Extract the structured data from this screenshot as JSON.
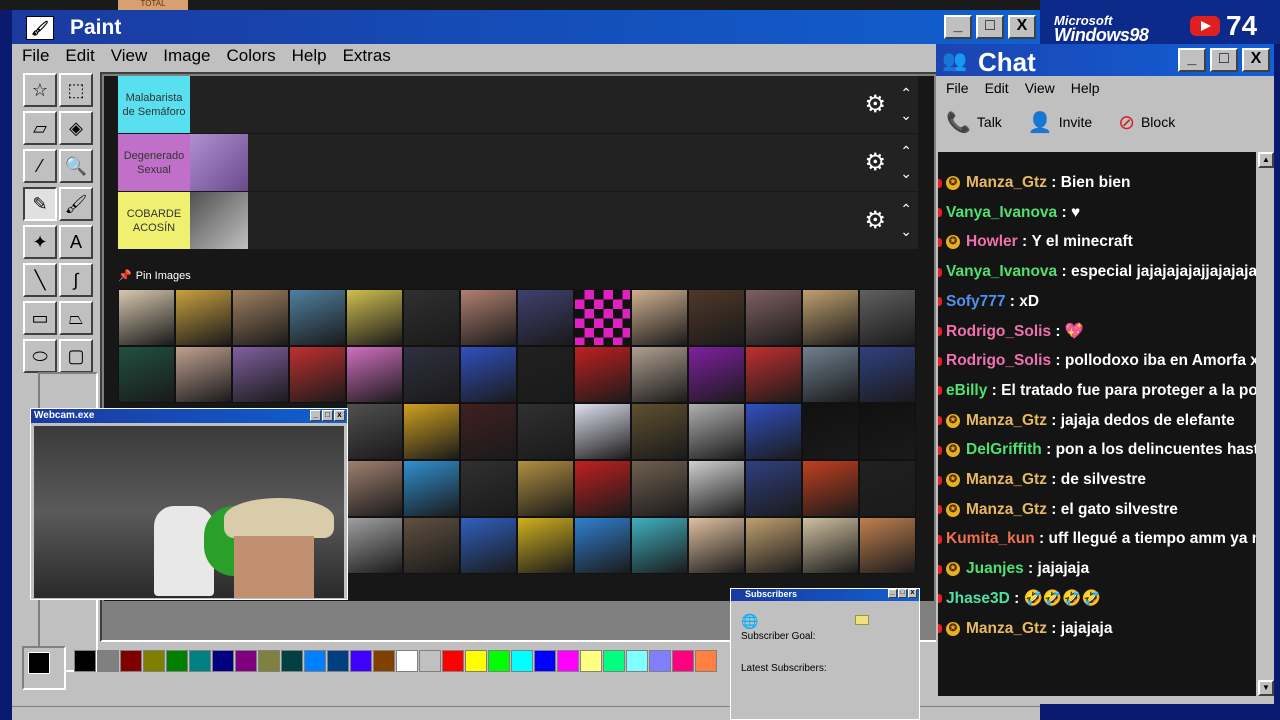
{
  "topbar": {
    "total_label": "TOTAL"
  },
  "brand": {
    "microsoft": "Microsoft",
    "windows": "Windows98",
    "youtube_count": "74"
  },
  "paint": {
    "title": "Paint",
    "menu": [
      "File",
      "Edit",
      "View",
      "Image",
      "Colors",
      "Help",
      "Extras"
    ],
    "window_buttons": {
      "minimize": "_",
      "maximize": "□",
      "close": "X"
    }
  },
  "tiers": [
    {
      "label": "Malabarista de Semáforo",
      "color": "#58e0f0"
    },
    {
      "label": "Degenerado Sexual",
      "color": "#c070c8"
    },
    {
      "label": "COBARDE ACOSÍN",
      "color": "#f0f070"
    }
  ],
  "pin_images_label": "Pin Images",
  "palette_colors": [
    "#000000",
    "#808080",
    "#800000",
    "#808000",
    "#008000",
    "#008080",
    "#000080",
    "#800080",
    "#808040",
    "#004040",
    "#0080ff",
    "#004080",
    "#4000ff",
    "#804000",
    "#ffffff",
    "#c0c0c0",
    "#ff0000",
    "#ffff00",
    "#00ff00",
    "#00ffff",
    "#0000ff",
    "#ff00ff",
    "#ffff80",
    "#00ff80",
    "#80ffff",
    "#8080ff",
    "#ff0080",
    "#ff8040"
  ],
  "chat": {
    "title": "Chat",
    "menu": [
      "File",
      "Edit",
      "View",
      "Help"
    ],
    "tools": [
      {
        "label": "Talk",
        "icon": "phone-icon"
      },
      {
        "label": "Invite",
        "icon": "invite-icon"
      },
      {
        "label": "Block",
        "icon": "block-icon"
      }
    ],
    "messages": [
      {
        "user": "Manza_Gtz",
        "text": "Bien bien",
        "color": "#e8b860",
        "star": true
      },
      {
        "user": "Vanya_Ivanova",
        "text": "♥",
        "color": "#50e070",
        "star": false
      },
      {
        "user": "Howler",
        "text": "Y el minecraft",
        "color": "#f070b0",
        "star": true
      },
      {
        "user": "Vanya_Ivanova",
        "text": "especial jajajajajajjajajaja",
        "color": "#50e070",
        "star": false
      },
      {
        "user": "Sofy777",
        "text": "xD",
        "color": "#5090f0",
        "star": false
      },
      {
        "user": "Rodrigo_Solis",
        "text": "💖",
        "color": "#f070b0",
        "star": false
      },
      {
        "user": "Rodrigo_Solis",
        "text": "pollodoxo iba en Amorfa xD",
        "color": "#f070b0",
        "star": false
      },
      {
        "user": "eBilly",
        "text": "El tratado fue para proteger a la pollo b",
        "color": "#50e070",
        "star": false
      },
      {
        "user": "Manza_Gtz",
        "text": "jajaja dedos de elefante",
        "color": "#e8b860",
        "star": true
      },
      {
        "user": "DelGriffith",
        "text": "pon a los delincuentes hasta ab",
        "color": "#50e070",
        "star": true
      },
      {
        "user": "Manza_Gtz",
        "text": "de silvestre",
        "color": "#e8b860",
        "star": true
      },
      {
        "user": "Manza_Gtz",
        "text": "el gato silvestre",
        "color": "#e8b860",
        "star": true
      },
      {
        "user": "Kumita_kun",
        "text": "uff llegué a tiempo amm ya me p",
        "color": "#f07050",
        "star": false
      },
      {
        "user": "Juanjes",
        "text": "jajajaja",
        "color": "#50e070",
        "star": true
      },
      {
        "user": "Jhase3D",
        "text": "🤣🤣🤣🤣",
        "color": "#50e0a0",
        "star": false
      },
      {
        "user": "Manza_Gtz",
        "text": "jajajaja",
        "color": "#e8b860",
        "star": true
      }
    ]
  },
  "webcam": {
    "title": "Webcam.exe"
  },
  "subscribers": {
    "title": "Subscribers",
    "goal_label": "Subscriber Goal:",
    "latest_label": "Latest Subscribers:"
  }
}
